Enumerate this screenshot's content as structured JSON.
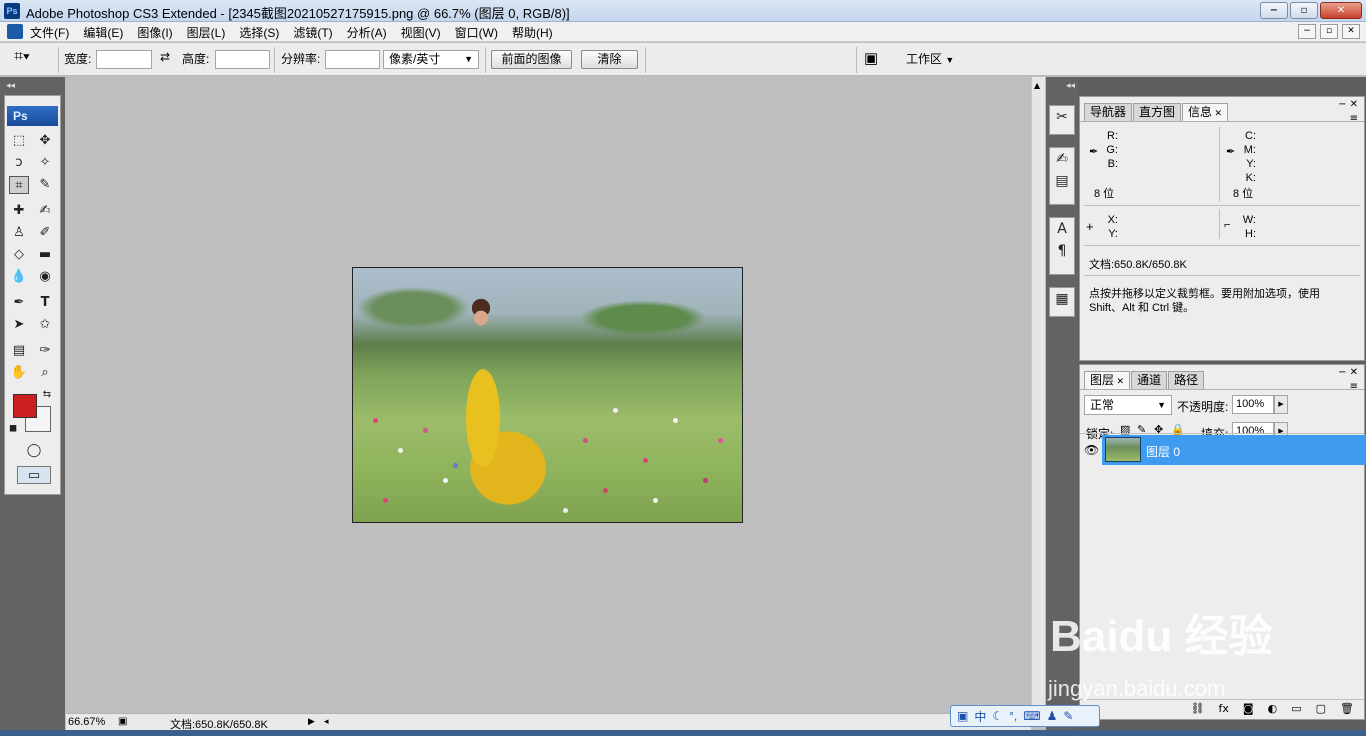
{
  "window": {
    "title": "Adobe Photoshop CS3 Extended - [2345截图20210527175915.png @ 66.7% (图层 0, RGB/8)]",
    "app_icon_label": "Ps",
    "minimize": "−",
    "maximize": "▫",
    "close": "✕"
  },
  "menu": {
    "items": [
      "文件(F)",
      "编辑(E)",
      "图像(I)",
      "图层(L)",
      "选择(S)",
      "滤镜(T)",
      "分析(A)",
      "视图(V)",
      "窗口(W)",
      "帮助(H)"
    ],
    "doc_minimize": "−",
    "doc_restore": "▫",
    "doc_close": "✕"
  },
  "options": {
    "width_label": "宽度:",
    "swap_icon": "⇄",
    "height_label": "高度:",
    "resolution_label": "分辨率:",
    "unit_select": "像素/英寸",
    "front_image_button": "前面的图像",
    "clear_button": "清除",
    "workspace_label": "工作区"
  },
  "toolbox": {
    "badge": "Ps"
  },
  "statusbar": {
    "zoom": "66.67%",
    "doc_size": "文档:650.8K/650.8K"
  },
  "info_panel": {
    "tabs": [
      "导航器",
      "直方图",
      "信息"
    ],
    "rgb_labels": [
      "R:",
      "G:",
      "B:"
    ],
    "cmyk_labels": [
      "C:",
      "M:",
      "Y:",
      "K:"
    ],
    "bit_depth_left": "8 位",
    "bit_depth_right": "8 位",
    "xy_labels": [
      "X:",
      "Y:"
    ],
    "wh_labels": [
      "W:",
      "H:"
    ],
    "doc_size": "文档:650.8K/650.8K",
    "hint_line1": "点按并拖移以定义裁剪框。要用附加选项，使用",
    "hint_line2": "Shift、Alt 和 Ctrl 键。"
  },
  "layers_panel": {
    "tabs": [
      "图层",
      "通道",
      "路径"
    ],
    "blend_mode": "正常",
    "opacity_label": "不透明度:",
    "opacity_value": "100%",
    "lock_label": "锁定:",
    "fill_label": "填充:",
    "fill_value": "100%",
    "layers": [
      {
        "name": "图层 0"
      }
    ]
  },
  "ime": {
    "mode": "中"
  },
  "watermark": {
    "brand": "Baidu 经验",
    "url": "jingyan.baidu.com"
  }
}
